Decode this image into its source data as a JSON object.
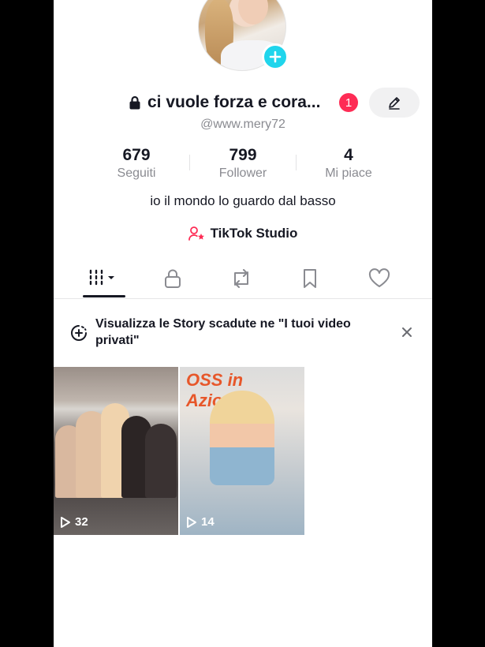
{
  "profile": {
    "name": "ci vuole forza e cora...",
    "handle": "@www.mery72",
    "notification_count": "1",
    "bio": "io il mondo lo guardo dal basso",
    "studio_label": "TikTok Studio"
  },
  "stats": [
    {
      "value": "679",
      "label": "Seguiti"
    },
    {
      "value": "799",
      "label": "Follower"
    },
    {
      "value": "4",
      "label": "Mi piace"
    }
  ],
  "tabs": [
    "videos-icon",
    "lock-icon",
    "repost-icon",
    "bookmark-icon",
    "heart-icon"
  ],
  "banner": {
    "text": "Visualizza le Story scadute ne \"I tuoi video privati\""
  },
  "videos": [
    {
      "views": "32"
    },
    {
      "views": "14",
      "caption": "OSS in Azione!"
    }
  ],
  "colors": {
    "accent_red": "#fe2c55",
    "add_blue": "#20d5ec",
    "text": "#161823",
    "secondary": "#8a8b91"
  }
}
